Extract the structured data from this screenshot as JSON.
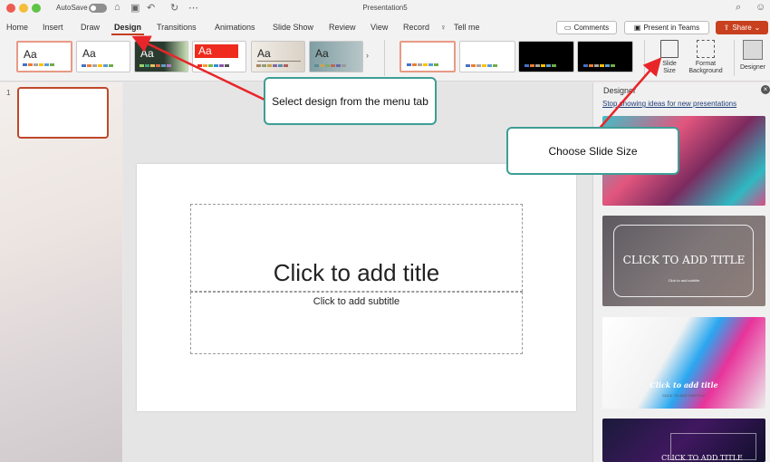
{
  "window": {
    "title": "Presentation5",
    "autosave_label": "AutoSave"
  },
  "tabs": [
    {
      "label": "Home"
    },
    {
      "label": "Insert"
    },
    {
      "label": "Draw"
    },
    {
      "label": "Design"
    },
    {
      "label": "Transitions"
    },
    {
      "label": "Animations"
    },
    {
      "label": "Slide Show"
    },
    {
      "label": "Review"
    },
    {
      "label": "View"
    },
    {
      "label": "Record"
    },
    {
      "label": "Tell me"
    }
  ],
  "header_buttons": {
    "comments": "Comments",
    "present": "Present in Teams",
    "share": "Share"
  },
  "themes": {
    "glyph": "Aa",
    "more_glyph": "›"
  },
  "tools": {
    "slide_size": "Slide Size",
    "format_background": "Format Background",
    "designer": "Designer"
  },
  "thumbnails": {
    "slide_number": "1"
  },
  "slide": {
    "title_placeholder": "Click to add title",
    "subtitle_placeholder": "Click to add subtitle"
  },
  "designer_pane": {
    "title": "Designer",
    "link": "Stop showing ideas for new presentations",
    "card2_title": "CLICK TO ADD TITLE",
    "card2_sub": "Click to add subtitle",
    "card3_title": "Click to add title",
    "card3_sub": "CLICK TO ADD SUBTITLE",
    "card4_title": "CLICK TO ADD TITLE"
  },
  "annotations": {
    "design_callout": "Select design from the menu tab",
    "size_callout": "Choose Slide Size"
  },
  "colors": {
    "accent": "#c8401e",
    "callout_border": "#3e9e95",
    "arrow": "#e8262a"
  }
}
